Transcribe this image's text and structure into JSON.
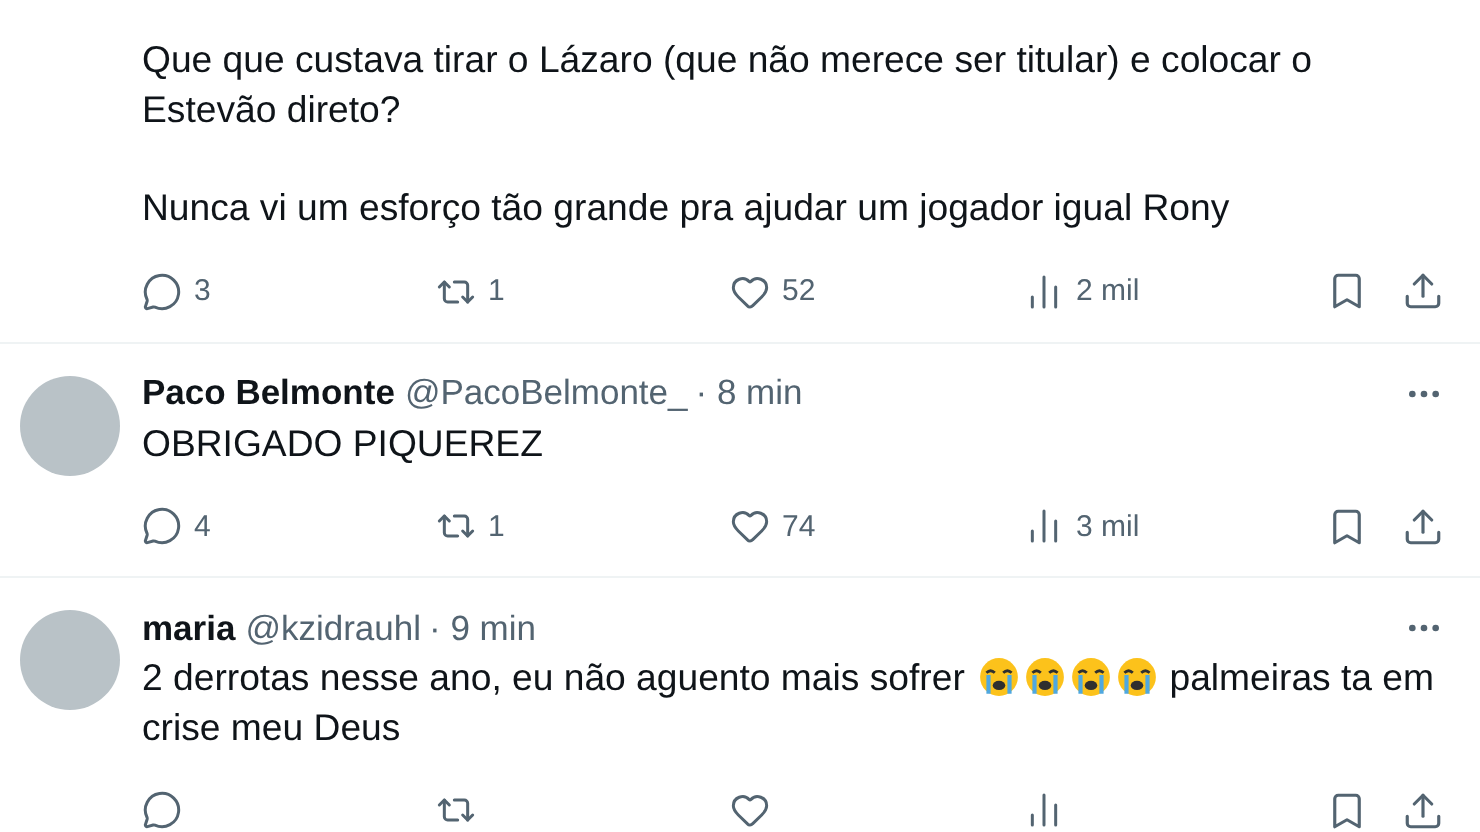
{
  "tweets": [
    {
      "paragraphs": [
        [
          {
            "kind": "text",
            "text": "Que que custava tirar o Lázaro (que não merece ser titular) e colocar o Estevão direto?"
          }
        ],
        [
          {
            "kind": "text",
            "text": "Nunca vi um esforço tão grande pra ajudar um jogador igual Rony"
          }
        ]
      ],
      "stats": {
        "replies": "3",
        "reposts": "1",
        "likes": "52",
        "views": "2 mil"
      }
    },
    {
      "author": {
        "name": "Paco Belmonte",
        "handle": "@PacoBelmonte_",
        "time": "· 8 min"
      },
      "paragraphs": [
        [
          {
            "kind": "text",
            "text": "OBRIGADO PIQUEREZ"
          }
        ]
      ],
      "stats": {
        "replies": "4",
        "reposts": "1",
        "likes": "74",
        "views": "3 mil"
      }
    },
    {
      "author": {
        "name": "maria",
        "handle": "@kzidrauhl",
        "time": "· 9 min"
      },
      "paragraphs": [
        [
          {
            "kind": "text",
            "text": "2 derrotas nesse ano, eu não aguento mais sofrer "
          },
          {
            "kind": "emoji"
          },
          {
            "kind": "emoji"
          },
          {
            "kind": "emoji"
          },
          {
            "kind": "emoji"
          },
          {
            "kind": "text",
            "text": " palmeiras ta em crise meu Deus"
          }
        ]
      ]
    }
  ]
}
